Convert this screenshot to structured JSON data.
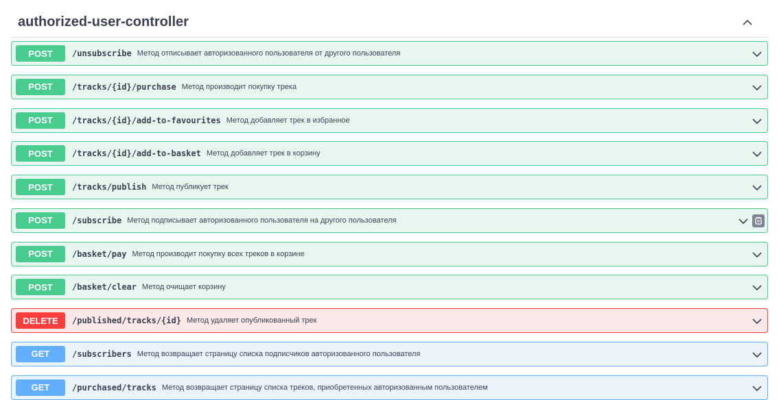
{
  "tag": {
    "title": "authorized-user-controller",
    "collapse_icon": "chevron-up-icon"
  },
  "operations": [
    {
      "method": "POST",
      "path": "/unsubscribe",
      "summary": "Метод отписывает авторизованного пользователя от другого пользователя"
    },
    {
      "method": "POST",
      "path": "/tracks/{id}/purchase",
      "summary": "Метод производит покупку трека"
    },
    {
      "method": "POST",
      "path": "/tracks/{id}/add-to-favourites",
      "summary": "Метод добавляет трек в избранное"
    },
    {
      "method": "POST",
      "path": "/tracks/{id}/add-to-basket",
      "summary": "Метод добавляет трек в корзину"
    },
    {
      "method": "POST",
      "path": "/tracks/publish",
      "summary": "Метод публикует трек"
    },
    {
      "method": "POST",
      "path": "/subscribe",
      "summary": "Метод подписывает авторизованного пользователя на другого пользователя",
      "copy_icon": "copy-to-clipboard-icon"
    },
    {
      "method": "POST",
      "path": "/basket/pay",
      "summary": "Метод производит покупку всех треков в корзине"
    },
    {
      "method": "POST",
      "path": "/basket/clear",
      "summary": "Метод очищает корзину"
    },
    {
      "method": "DELETE",
      "path": "/published/tracks/{id}",
      "summary": "Метод удаляет опубликованный трек"
    },
    {
      "method": "GET",
      "path": "/subscribers",
      "summary": "Метод возвращает страницу списка подписчиков авторизованного пользователя"
    },
    {
      "method": "GET",
      "path": "/purchased/tracks",
      "summary": "Метод возвращает страницу списка треков, приобретенных авторизованным пользователем"
    }
  ],
  "colors": {
    "post": "#49cc90",
    "delete": "#f93e3e",
    "get": "#61affe"
  }
}
